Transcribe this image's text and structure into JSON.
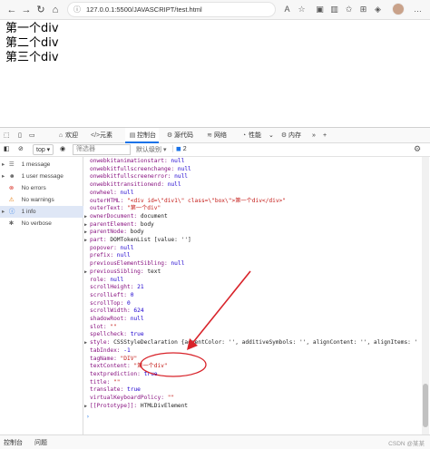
{
  "browser": {
    "url": "127.0.0.1:5500/JAVASCRIPT/test.html"
  },
  "page": {
    "lines": [
      "第一个div",
      "第二个div",
      "第三个div"
    ]
  },
  "devtools": {
    "tabs": [
      "欢迎",
      "元素",
      "控制台",
      "源代码",
      "网络",
      "性能",
      "内存"
    ],
    "toolbar": {
      "context": "top",
      "filter_placeholder": "筛选器",
      "level": "默认级别",
      "issues_count": "2"
    },
    "sidebar": [
      {
        "label": "1 message",
        "icon": "list-icon"
      },
      {
        "label": "1 user message",
        "icon": "user-icon"
      },
      {
        "label": "No errors",
        "icon": "error-icon"
      },
      {
        "label": "No warnings",
        "icon": "warning-icon"
      },
      {
        "label": "1 info",
        "icon": "info-icon"
      },
      {
        "label": "No verbose",
        "icon": "bug-icon"
      }
    ],
    "console_lines": [
      "onwebkitanimationstart: null",
      "onwebkitfullscreenchange: null",
      "onwebkitfullscreenerror: null",
      "onwebkittransitionend: null",
      "onwheel: null",
      "outerHTML: \"<div id=\\\"div1\\\" class=\\\"box\\\">第一个div</div>\"",
      "outerText: \"第一个div\"",
      "ownerDocument: document",
      "parentElement: body",
      "parentNode: body",
      "part: DOMTokenList [value: '']",
      "popover: null",
      "prefix: null",
      "previousElementSibling: null",
      "previousSibling: text",
      "role: null",
      "scrollHeight: 21",
      "scrollLeft: 0",
      "scrollTop: 0",
      "scrollWidth: 624",
      "shadowRoot: null",
      "slot: \"\"",
      "spellcheck: true",
      "style: CSSStyleDeclaration {accentColor: '', additiveSymbols: '', alignContent: '', alignItems: '",
      "tabIndex: -1",
      "tagName: \"DIV\"",
      "textContent: \"第一个div\"",
      "textprediction: true",
      "title: \"\"",
      "translate: true",
      "virtualKeyboardPolicy: \"\"",
      "[[Prototype]]: HTMLDivElement"
    ],
    "expandable": [
      7,
      8,
      9,
      10,
      14,
      23,
      31
    ],
    "bottom_tabs": [
      "控制台",
      "问题"
    ],
    "watermark": "CSDN @某某"
  },
  "colors": {
    "annotation": "#d8232a",
    "accent": "#1a73e8"
  }
}
